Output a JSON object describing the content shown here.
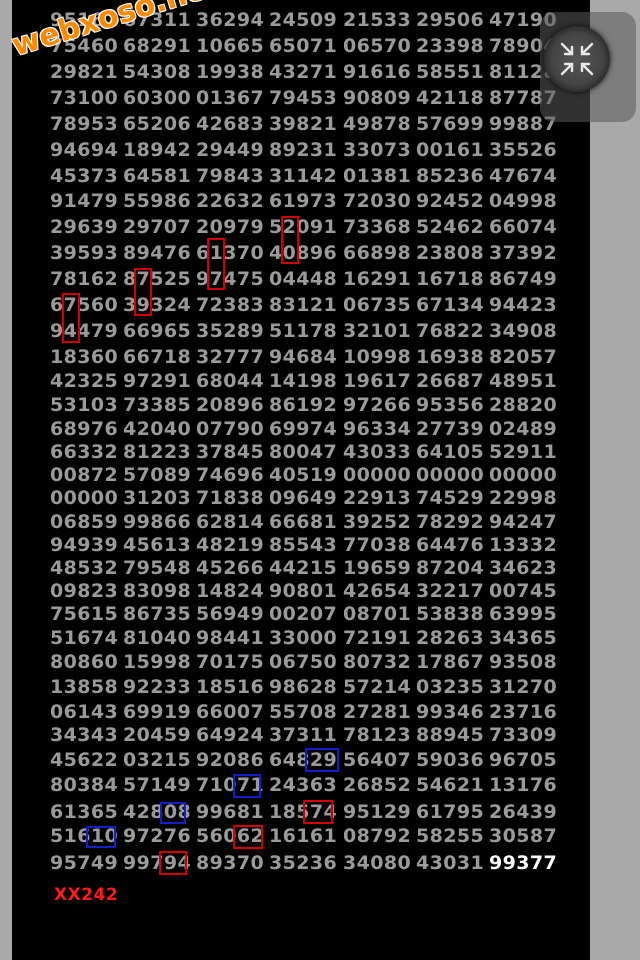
{
  "watermark": "webxoso.net",
  "caption": "XX242",
  "collapse_icon": "collapse-arrows-icon",
  "colors": {
    "text": "#9a9a9a",
    "highlight_text": "#ffffff",
    "red_box": "#d40000",
    "blue_box": "#1020c8",
    "caption": "#ff1a1a",
    "watermark": "#ff8a00"
  },
  "rows": [
    [
      "95167",
      "67311",
      "36294",
      "24509",
      "21533",
      "29506",
      "47190"
    ],
    [
      "75460",
      "68291",
      "10665",
      "65071",
      "06570",
      "23398",
      "78904"
    ],
    [
      "29821",
      "54308",
      "19938",
      "43271",
      "91616",
      "58551",
      "81128"
    ],
    [
      "73100",
      "60300",
      "01367",
      "79453",
      "90809",
      "42118",
      "87787"
    ],
    [
      "78953",
      "65206",
      "42683",
      "39821",
      "49878",
      "57699",
      "99887"
    ],
    [
      "94694",
      "18942",
      "29449",
      "89231",
      "33073",
      "00161",
      "35526"
    ],
    [
      "45373",
      "64581",
      "79843",
      "31142",
      "01381",
      "85236",
      "47674"
    ],
    [
      "91479",
      "55986",
      "22632",
      "61973",
      "72030",
      "92452",
      "04998"
    ],
    [
      "29639",
      "29707",
      "20979",
      "52091",
      "73368",
      "52462",
      "66074"
    ],
    [
      "39593",
      "89476",
      "61370",
      "40896",
      "66898",
      "23808",
      "37392"
    ],
    [
      "78162",
      "87525",
      "97475",
      "04448",
      "16291",
      "16718",
      "86749"
    ],
    [
      "67560",
      "39324",
      "72383",
      "83121",
      "06735",
      "67134",
      "94423"
    ],
    [
      "94479",
      "66965",
      "35289",
      "51178",
      "32101",
      "76822",
      "34908"
    ],
    [
      "18360",
      "66718",
      "32777",
      "94684",
      "10998",
      "16938",
      "82057"
    ],
    [
      "42325",
      "97291",
      "68044",
      "14198",
      "19617",
      "26687",
      "48951"
    ],
    [
      "53103",
      "73385",
      "20896",
      "86192",
      "97266",
      "95356",
      "28820"
    ],
    [
      "68976",
      "42040",
      "07790",
      "69974",
      "96334",
      "27739",
      "02489"
    ],
    [
      "66332",
      "81223",
      "37845",
      "80047",
      "43033",
      "64105",
      "52911"
    ],
    [
      "00872",
      "57089",
      "74696",
      "40519",
      "00000",
      "00000",
      "00000"
    ],
    [
      "00000",
      "31203",
      "71838",
      "09649",
      "22913",
      "74529",
      "22998"
    ],
    [
      "06859",
      "99866",
      "62814",
      "66681",
      "39252",
      "78292",
      "94247"
    ],
    [
      "94939",
      "45613",
      "48219",
      "85543",
      "77038",
      "64476",
      "13332"
    ],
    [
      "48532",
      "79548",
      "45266",
      "44215",
      "19659",
      "87204",
      "34623"
    ],
    [
      "09823",
      "83098",
      "14824",
      "90801",
      "42654",
      "32217",
      "00745"
    ],
    [
      "75615",
      "86735",
      "56949",
      "00207",
      "08701",
      "53838",
      "63995"
    ],
    [
      "51674",
      "81040",
      "98441",
      "33000",
      "72191",
      "28263",
      "34365"
    ],
    [
      "80860",
      "15998",
      "70175",
      "06750",
      "80732",
      "17867",
      "93508"
    ],
    [
      "13858",
      "92233",
      "18516",
      "98628",
      "57214",
      "03235",
      "31270"
    ],
    [
      "06143",
      "69919",
      "66007",
      "55708",
      "27281",
      "99346",
      "23716"
    ],
    [
      "34343",
      "20459",
      "64924",
      "37311",
      "78123",
      "88945",
      "73309"
    ],
    [
      "45622",
      "03215",
      "92086",
      "64829",
      "56407",
      "59036",
      "96705"
    ],
    [
      "80384",
      "57149",
      "71071",
      "24363",
      "26852",
      "54621",
      "13176"
    ],
    [
      "61365",
      "42808",
      "99681",
      "18574",
      "95129",
      "61795",
      "26439"
    ],
    [
      "51610",
      "97276",
      "56062",
      "16161",
      "08792",
      "58255",
      "30587"
    ],
    [
      "95749",
      "99794",
      "89370",
      "35236",
      "34080",
      "43031",
      "99377"
    ]
  ]
}
